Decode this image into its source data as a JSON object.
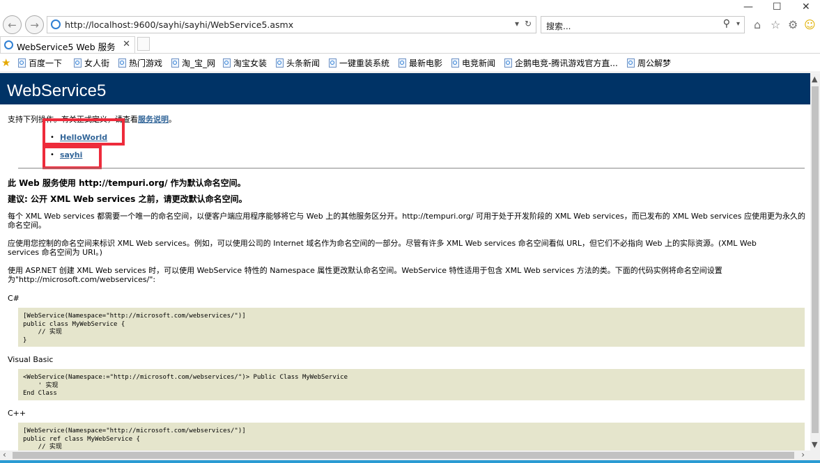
{
  "browser": {
    "window_controls": [
      "—",
      "☐",
      "✕"
    ],
    "address": "http://localhost:9600/sayhi/sayhi/WebService5.asmx",
    "search_placeholder": "搜索...",
    "tab_title": "WebService5 Web 服务"
  },
  "favorites": [
    "百度一下",
    "女人街",
    "热门游戏",
    "淘_宝_网",
    "淘宝女装",
    "头条新闻",
    "一键重装系统",
    "最新电影",
    "电竞新闻",
    "企鹅电竞-腾讯游戏官方直...",
    "周公解梦"
  ],
  "page": {
    "header_title": "WebService5",
    "intro_prefix": "支持下列操作。有关正式定义，请查看",
    "intro_link": "服务说明",
    "intro_suffix": "。",
    "operations": [
      "HelloWorld",
      "sayhi"
    ],
    "ns_heading1": "此 Web 服务使用 http://tempuri.org/ 作为默认命名空间。",
    "ns_heading2": "建议: 公开 XML Web services 之前，请更改默认命名空间。",
    "para1": "每个 XML Web services 都需要一个唯一的命名空间，以便客户端应用程序能够将它与 Web 上的其他服务区分开。http://tempuri.org/ 可用于处于开发阶段的 XML Web services，而已发布的 XML Web services 应使用更为永久的命名空间。",
    "para2": "应使用您控制的命名空间来标识 XML Web services。例如，可以使用公司的 Internet 域名作为命名空间的一部分。尽管有许多 XML Web services 命名空间看似 URL，但它们不必指向 Web 上的实际资源。(XML Web services 命名空间为 URI。)",
    "para3": "使用 ASP.NET 创建 XML Web services 时，可以使用 WebService 特性的 Namespace 属性更改默认命名空间。WebService 特性适用于包含 XML Web services 方法的类。下面的代码实例将命名空间设置为\"http://microsoft.com/webservices/\":",
    "label_cs": "C#",
    "code_cs": "[WebService(Namespace=\"http://microsoft.com/webservices/\")]\npublic class MyWebService {\n    // 实现\n}",
    "label_vb": "Visual Basic",
    "code_vb": "<WebService(Namespace:=\"http://microsoft.com/webservices/\")> Public Class MyWebService\n    ' 实现\nEnd Class",
    "label_cpp": "C++",
    "code_cpp": "[WebService(Namespace=\"http://microsoft.com/webservices/\")]\npublic ref class MyWebService {\n    // 实现"
  },
  "colors": {
    "header_bg": "#003366",
    "link": "#336699",
    "code_bg": "#e5e5cc",
    "highlight": "#ee2b3b"
  }
}
